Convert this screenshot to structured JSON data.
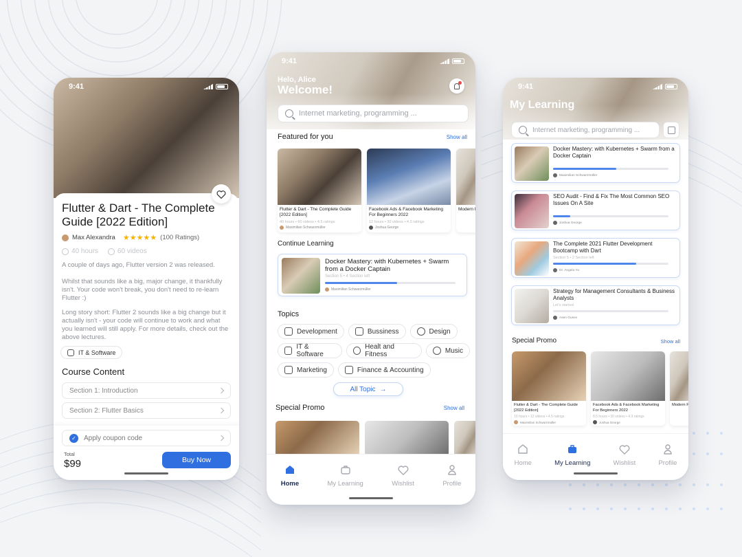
{
  "accent": "#2f6fe0",
  "phone1": {
    "time": "9:41",
    "course_title": "Flutter & Dart - The Complete Guide [2022 Edition]",
    "author": "Max Alexandra",
    "rating": 5,
    "ratings_count": "(100 Ratings)",
    "hours": "40 hours",
    "videos": "60 videos",
    "desc1": "A couple of days ago, Flutter version 2 was released.",
    "desc2": "Whilst that sounds like a big, major change, it thankfully isn't. Your code won't break, you don't need to re-learn Flutter :)",
    "desc3": "Long story short: Flutter 2 sounds like a big change but it actually isn't - your code will continue to work and what you learned will still apply. For more details, check out the above lectures.",
    "category": "IT & Software",
    "course_content_title": "Course Content",
    "sections": [
      "Section 1: Introduction",
      "Section 2: Flutter Basics"
    ],
    "coupon": "Apply coupon code",
    "total_label": "Total",
    "price": "$99",
    "buy_label": "Buy Now"
  },
  "phone2": {
    "time": "9:41",
    "greeting": "Helo, Alice",
    "welcome": "Welcome!",
    "search_placeholder": "Internet marketing, programming ...",
    "featured_title": "Featured for you",
    "show_all": "Show all",
    "featured": [
      {
        "title": "Flutter & Dart - The Complete Guide [2022 Edition]",
        "meta": "40 hours • 60 videos • 4.5 ratings",
        "author": "Maximilian Schwarzmüller",
        "img": "photo"
      },
      {
        "title": "Facebook Ads & Facebook Marketing For Beginners 2022",
        "meta": "12 hours • 30 videos • 4.3 ratings",
        "author": "Joshua George",
        "img": "photo laptop"
      },
      {
        "title": "Modern R",
        "meta": "",
        "author": "",
        "img": "photo office"
      }
    ],
    "continue_title": "Continue Learning",
    "continue_course": {
      "title": "Docker Mastery: with Kubernetes + Swarm from a Docker Captain",
      "meta": "Section 5 • 4 Section left",
      "author": "Maximilian Schwarzmüller",
      "progress": 0.55
    },
    "topics_title": "Topics",
    "topics": [
      [
        "Development",
        "Bussiness",
        "Design"
      ],
      [
        "IT & Software",
        "Healt and Fitness",
        "Music"
      ],
      [
        "Marketing",
        "Finance & Accounting"
      ]
    ],
    "all_topic": "All Topic",
    "special_title": "Special Promo",
    "show_all2": "Show all",
    "nav": [
      "Home",
      "My Learning",
      "Wishlist",
      "Profile"
    ]
  },
  "phone3": {
    "time": "9:41",
    "title": "My Learning",
    "search_placeholder": "Internet marketing, programming ...",
    "courses": [
      {
        "title": "Docker Mastery: with Kubernetes + Swarm from a Docker Captain",
        "meta": "",
        "author": "Maximilian Schwarzmüller",
        "progress": 0.55,
        "img": "photo docker"
      },
      {
        "title": "SEO Audit - Find & Fix The Most Common SEO Issues On A Site",
        "meta": "",
        "author": "Joshua George",
        "progress": 0.15,
        "img": "photo seo"
      },
      {
        "title": "The Complete 2021 Flutter Development Bootcamp with Dart",
        "meta": "Section 5 • 2 Section left",
        "author": "Dr. Angela Yu",
        "progress": 0.72,
        "img": "photo flutter"
      },
      {
        "title": "Strategy for Management Consultants & Business Analysts",
        "meta": "Let's started",
        "author": "Asen Gusev",
        "progress": 0.0,
        "img": "photo strategy"
      }
    ],
    "special_title": "Special Promo",
    "show_all": "Show all",
    "promos": [
      {
        "title": "Flutter & Dart - The Complete Guide [2022 Edition]",
        "meta": "10 hours • 12 videos • 4.5 ratings",
        "author": "Maximilian Schwarzmüller",
        "img": "photo promo1"
      },
      {
        "title": "Facebook Ads & Facebook Marketing For Beginners 2022",
        "meta": "8.5 hours • 30 videos • 4.3 ratings",
        "author": "Joshua George",
        "img": "photo promo2"
      },
      {
        "title": "Modern R",
        "meta": "",
        "author": "",
        "img": "photo office"
      }
    ],
    "nav": [
      "Home",
      "My Learning",
      "Wishlist",
      "Profile"
    ]
  }
}
